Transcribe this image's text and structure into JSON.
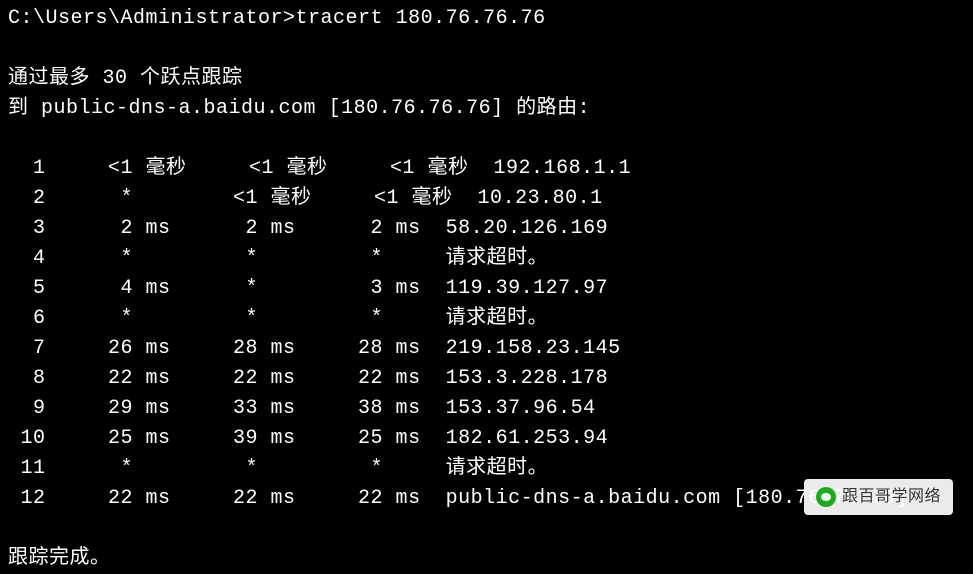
{
  "prompt": "C:\\Users\\Administrator>",
  "command": "tracert 180.76.76.76",
  "header_line1": "通过最多 30 个跃点跟踪",
  "header_line2_prefix": "到 ",
  "target_host": "public-dns-a.baidu.com",
  "target_ip": "[180.76.76.76]",
  "header_line2_suffix": " 的路由:",
  "hops": [
    {
      "n": "1",
      "t1": "<1 毫秒",
      "t2": "<1 毫秒",
      "t3": "<1 毫秒",
      "dest": "192.168.1.1"
    },
    {
      "n": "2",
      "t1": "*   ",
      "t2": "<1 毫秒",
      "t3": "<1 毫秒",
      "dest": "10.23.80.1"
    },
    {
      "n": "3",
      "t1": "2 ms",
      "t2": "2 ms",
      "t3": "2 ms",
      "dest": "58.20.126.169"
    },
    {
      "n": "4",
      "t1": "*   ",
      "t2": "*   ",
      "t3": "*   ",
      "dest": "请求超时。"
    },
    {
      "n": "5",
      "t1": "4 ms",
      "t2": "*   ",
      "t3": "3 ms",
      "dest": "119.39.127.97"
    },
    {
      "n": "6",
      "t1": "*   ",
      "t2": "*   ",
      "t3": "*   ",
      "dest": "请求超时。"
    },
    {
      "n": "7",
      "t1": "26 ms",
      "t2": "28 ms",
      "t3": "28 ms",
      "dest": "219.158.23.145"
    },
    {
      "n": "8",
      "t1": "22 ms",
      "t2": "22 ms",
      "t3": "22 ms",
      "dest": "153.3.228.178"
    },
    {
      "n": "9",
      "t1": "29 ms",
      "t2": "33 ms",
      "t3": "38 ms",
      "dest": "153.37.96.54"
    },
    {
      "n": "10",
      "t1": "25 ms",
      "t2": "39 ms",
      "t3": "25 ms",
      "dest": "182.61.253.94"
    },
    {
      "n": "11",
      "t1": "*   ",
      "t2": "*   ",
      "t3": "*   ",
      "dest": "请求超时。"
    },
    {
      "n": "12",
      "t1": "22 ms",
      "t2": "22 ms",
      "t3": "22 ms",
      "dest": "public-dns-a.baidu.com [180.76.76.76]"
    }
  ],
  "footer": "跟踪完成。",
  "watermark_text": "跟百哥学网络"
}
